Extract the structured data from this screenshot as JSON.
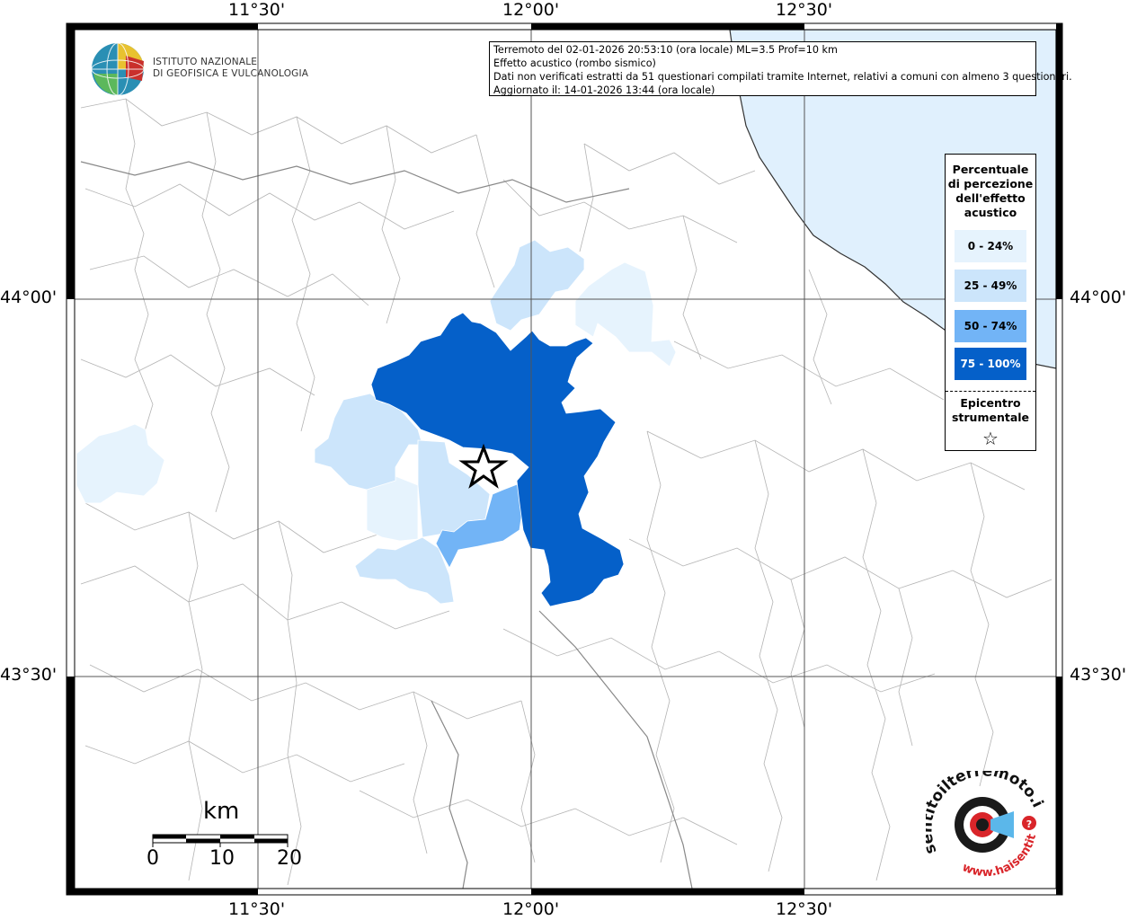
{
  "header": {
    "info_lines": [
      "Terremoto del 02-01-2026 20:53:10 (ora locale) ML=3.5 Prof=10 km",
      "Effetto acustico (rombo sismico)",
      "Dati non verificati estratti da 51 questionari compilati tramite Internet, relativi a comuni con almeno 3 questionari.",
      "Aggiornato il: 14-01-2026 13:44 (ora locale)"
    ]
  },
  "logo": {
    "line1": "ISTITUTO NAZIONALE",
    "line2": "DI GEOFISICA E VULCANOLOGIA",
    "icon": "ingv-globe-logo"
  },
  "axes": {
    "lon_ticks": [
      "11°30'",
      "12°00'",
      "12°30'"
    ],
    "lat_ticks": [
      "44°00'",
      "43°30'"
    ]
  },
  "legend": {
    "title": [
      "Percentuale",
      "di percezione",
      "dell'effetto",
      "acustico"
    ],
    "classes": [
      {
        "label": "0 - 24%",
        "color": "#e6f3fd",
        "text_color": "#000000"
      },
      {
        "label": "25 - 49%",
        "color": "#cce5fb",
        "text_color": "#000000"
      },
      {
        "label": "50 - 74%",
        "color": "#72b4f6",
        "text_color": "#000000"
      },
      {
        "label": "75 - 100%",
        "color": "#0560c9",
        "text_color": "#ffffff"
      }
    ],
    "epicenter_title": [
      "Epicentro",
      "strumentale"
    ],
    "epicenter_symbol": "☆"
  },
  "scale_bar": {
    "unit": "km",
    "labels": [
      "0",
      "10",
      "20"
    ]
  },
  "sea_color": "#e0f0fd",
  "branding": {
    "line": "sentitoilterremoto.it",
    "url": "www.haisentito"
  }
}
